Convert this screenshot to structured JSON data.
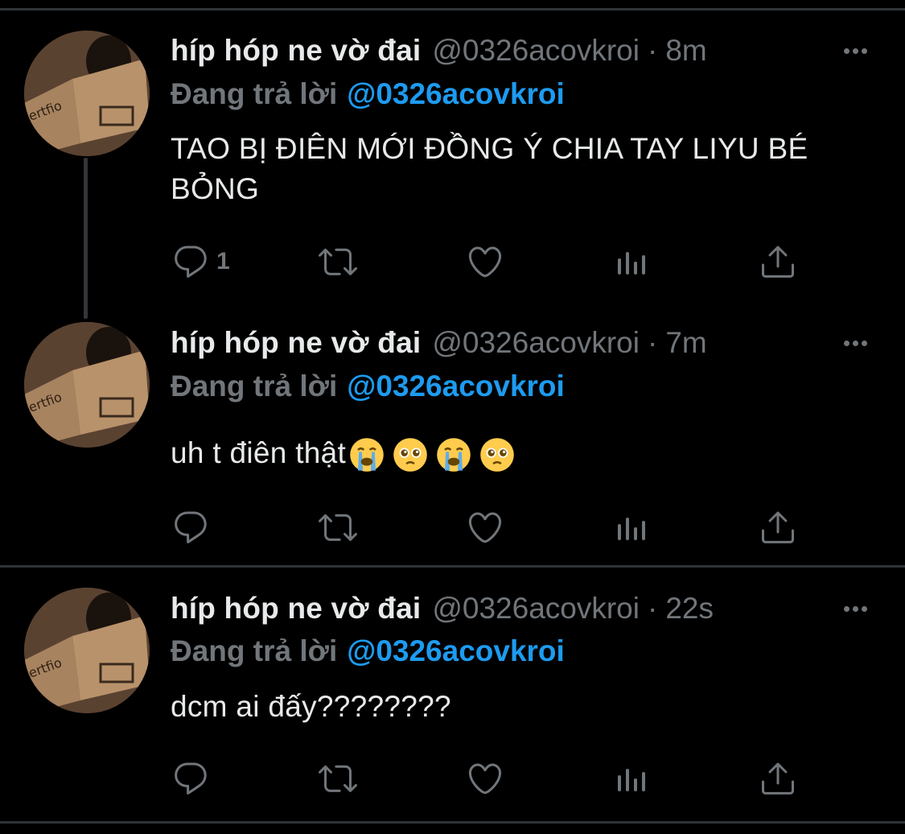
{
  "tweets": [
    {
      "display_name": "híp hóp ne vờ đai",
      "handle": "@0326acovkroi",
      "separator": "·",
      "time": "8m",
      "reply_prefix": "Đang trả lời",
      "reply_to": "@0326acovkroi",
      "text": "TAO BỊ ĐIÊN MỚI ĐỒNG Ý CHIA TAY LIYU BÉ BỎNG",
      "reply_count": "1",
      "emojis": []
    },
    {
      "display_name": "híp hóp ne vờ đai",
      "handle": "@0326acovkroi",
      "separator": "·",
      "time": "7m",
      "reply_prefix": "Đang trả lời",
      "reply_to": "@0326acovkroi",
      "text": "uh t điên thật",
      "reply_count": "",
      "emojis": [
        "loudly-crying-face",
        "pleading-face",
        "loudly-crying-face",
        "pleading-face"
      ]
    },
    {
      "display_name": "híp hóp ne vờ đai",
      "handle": "@0326acovkroi",
      "separator": "·",
      "time": "22s",
      "reply_prefix": "Đang trả lời",
      "reply_to": "@0326acovkroi",
      "text": "dcm ai đấy????????",
      "reply_count": "",
      "emojis": []
    }
  ],
  "icons": {
    "reply": "reply-icon",
    "retweet": "retweet-icon",
    "like": "like-icon",
    "analytics": "analytics-icon",
    "share": "share-icon",
    "more": "more-icon"
  },
  "colors": {
    "background": "#000000",
    "text": "#e7e9ea",
    "muted": "#71767b",
    "accent": "#1d9bf0",
    "divider": "#2f3336"
  }
}
